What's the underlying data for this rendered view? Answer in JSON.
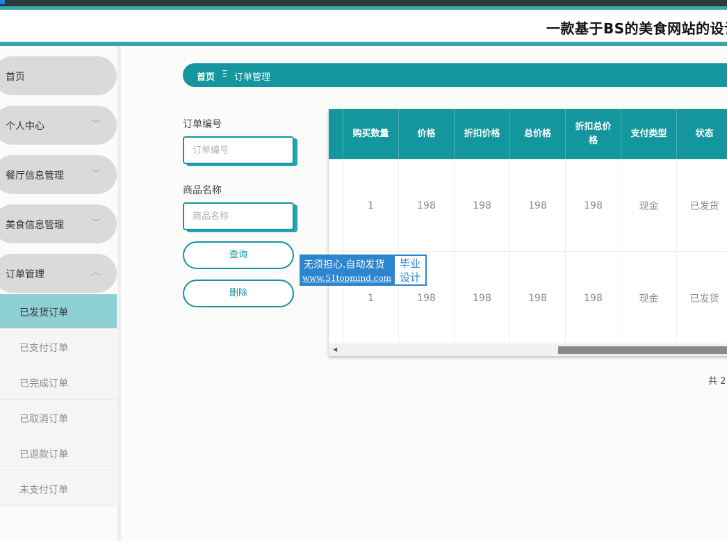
{
  "header": {
    "site_title": "一款基于BS的美食网站的设计"
  },
  "sidebar": {
    "items": [
      {
        "label": "首页",
        "chevron": ""
      },
      {
        "label": "个人中心",
        "chevron": "﹀"
      },
      {
        "label": "餐厅信息管理",
        "chevron": "﹀"
      },
      {
        "label": "美食信息管理",
        "chevron": "﹀"
      },
      {
        "label": "订单管理",
        "chevron": "︿"
      }
    ],
    "subitems": [
      {
        "label": "已发货订单"
      },
      {
        "label": "已支付订单"
      },
      {
        "label": "已完成订单"
      },
      {
        "label": "已取消订单"
      },
      {
        "label": "已退款订单"
      },
      {
        "label": "未支付订单"
      }
    ]
  },
  "breadcrumb": {
    "home": "首页",
    "separator": "Ξ",
    "current": "订单管理"
  },
  "search": {
    "order_no_label": "订单编号",
    "order_no_placeholder": "订单编号",
    "product_label": "商品名称",
    "product_placeholder": "商品名称",
    "query_button": "查询",
    "delete_button": "删除"
  },
  "table": {
    "headers": [
      "",
      "购买数量",
      "价格",
      "折扣价格",
      "总价格",
      "折扣总价格",
      "支付类型",
      "状态"
    ],
    "rows": [
      [
        "",
        "1",
        "198",
        "198",
        "198",
        "198",
        "现金",
        "已发货"
      ],
      [
        "",
        "1",
        "198",
        "198",
        "198",
        "198",
        "现金",
        "已发货"
      ]
    ]
  },
  "watermark": {
    "line1": "无须担心.自动发货",
    "line2": "www.51topmind.com",
    "right1": "毕业",
    "right2": "设计"
  },
  "pagination": {
    "total_text": "共 2"
  },
  "colors": {
    "accent": "#13969d",
    "menu_bg": "#dadad9",
    "active_sub": "#8fd0d5",
    "watermark": "#2d84cf"
  }
}
